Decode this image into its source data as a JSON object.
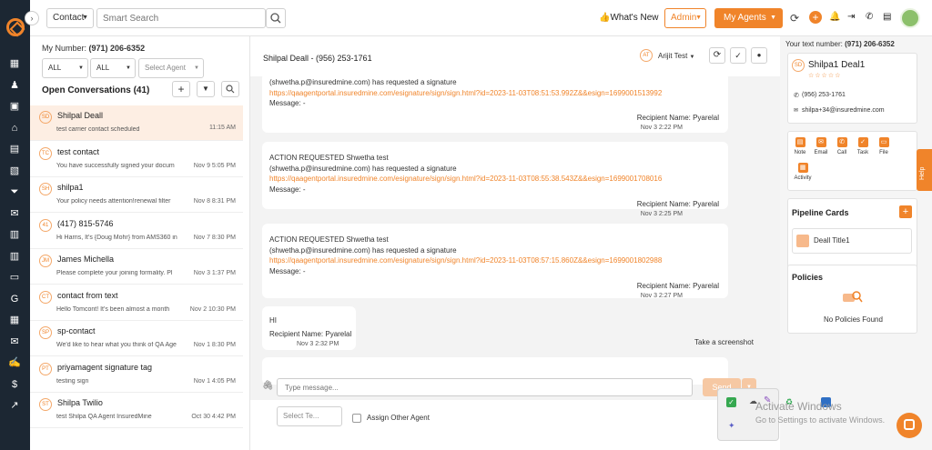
{
  "sidebar": {
    "icons": [
      "dashboard-icon",
      "contacts-icon",
      "documents-icon",
      "bank-icon",
      "calendar-icon",
      "id-card-icon",
      "filter-icon",
      "megaphone-icon",
      "chat-icon",
      "reports-icon",
      "folder-icon",
      "google-icon",
      "event-icon",
      "mail-icon",
      "signature-icon",
      "dollar-icon",
      "analytics-icon"
    ]
  },
  "topbar": {
    "contact_select": "Contact",
    "search_placeholder": "Smart Search",
    "whats_new": "What's New",
    "admin": "Admin",
    "my_agents": "My Agents"
  },
  "left": {
    "my_number_label": "My Number:",
    "my_number": "(971) 206-6352",
    "filter1": "ALL",
    "filter2": "ALL",
    "filter3": "Select Agent",
    "open_conversations": "Open Conversations (41)",
    "conversations": [
      {
        "initials": "SD",
        "name": "Shilpal Deall",
        "preview": "test carrier contact scheduled",
        "time": "11:15 AM",
        "active": true
      },
      {
        "initials": "TC",
        "name": "test contact",
        "preview": "You have successfully signed your docum",
        "time": "Nov 9 5:05 PM"
      },
      {
        "initials": "SH",
        "name": "shilpa1",
        "preview": "Your policy needs attention!renewal filter",
        "time": "Nov 8 8:31 PM"
      },
      {
        "initials": "41",
        "name": "(417) 815-5746",
        "preview": "Hi Harris, It's {Doug Mohr} from AMS360 in",
        "time": "Nov 7 8:30 PM"
      },
      {
        "initials": "JM",
        "name": "James Michella",
        "preview": "Please complete your joining formality. Pl",
        "time": "Nov 3 1:37 PM"
      },
      {
        "initials": "CT",
        "name": "contact from text",
        "preview": "Hello Tomcont! It's been almost a month",
        "time": "Nov 2 10:30 PM"
      },
      {
        "initials": "SP",
        "name": "sp-contact",
        "preview": "We'd like to hear what you think of QA Age",
        "time": "Nov 1 8:30 PM"
      },
      {
        "initials": "PT",
        "name": "priyamagent signature tag",
        "preview": "testing sign",
        "time": "Nov 1 4:05 PM"
      },
      {
        "initials": "ST",
        "name": "Shilpa Twilio",
        "preview": "test Shilpa QA Agent InsuredMine",
        "time": "Oct 30 4:42 PM"
      }
    ]
  },
  "center": {
    "title": "Shilpal Deall - (956) 253-1761",
    "agent_initials": "AT",
    "agent_name": "Arijit Test",
    "messages": [
      {
        "lines": [
          "(shwetha.p@insuredmine.com) has requested a signature"
        ],
        "link": "https://qaagentportal.insuredmine.com/esignature/sign/sign.html?id=2023-11-03T08:51:53.992Z&&esign=1699001513992",
        "message": "Message: -",
        "recipient": "Recipient Name: Pyarelal",
        "date": "Nov 3 2:22 PM"
      },
      {
        "lines": [
          "ACTION REQUESTED Shwetha test",
          "(shwetha.p@insuredmine.com) has requested a signature"
        ],
        "link": "https://qaagentportal.insuredmine.com/esignature/sign/sign.html?id=2023-11-03T08:55:38.543Z&&esign=1699001708016",
        "message": "Message: -",
        "recipient": "Recipient Name: Pyarelal",
        "date": "Nov 3 2:25 PM"
      },
      {
        "lines": [
          "ACTION REQUESTED Shwetha test",
          "(shwetha.p@insuredmine.com) has requested a signature"
        ],
        "link": "https://qaagentportal.insuredmine.com/esignature/sign/sign.html?id=2023-11-03T08:57:15.860Z&&esign=1699001802988",
        "message": "Message: -",
        "recipient": "Recipient Name: Pyarelal",
        "date": "Nov 3 2:27 PM"
      }
    ],
    "short_message": {
      "text": "HI",
      "recipient": "Recipient Name: Pyarelal",
      "date": "Nov 3 2:32 PM"
    },
    "screenshot_tip": "Take a screenshot",
    "input_placeholder": "Type message...",
    "send": "Send",
    "select_template": "Select Te...",
    "assign_other_agent": "Assign Other Agent"
  },
  "right": {
    "text_number_label": "Your text number:",
    "text_number": "(971) 206-6352",
    "contact_initials": "SD",
    "contact_name": "Shilpa1 Deal1",
    "stars": "☆☆☆☆☆",
    "phone": "(956) 253-1761",
    "email": "shilpa+34@insuredmine.com",
    "actions": [
      "Note",
      "Email",
      "Call",
      "Task",
      "File",
      "Activity"
    ],
    "pipeline_title": "Pipeline Cards",
    "pipeline_card": "Deall Title1",
    "policies_title": "Policies",
    "no_policies": "No Policies Found",
    "help": "Help"
  },
  "overlay": {
    "activate_title": "Activate Windows",
    "activate_sub": "Go to Settings to activate Windows."
  },
  "colors": {
    "accent": "#f0842a",
    "sidebar": "#1c2733"
  }
}
